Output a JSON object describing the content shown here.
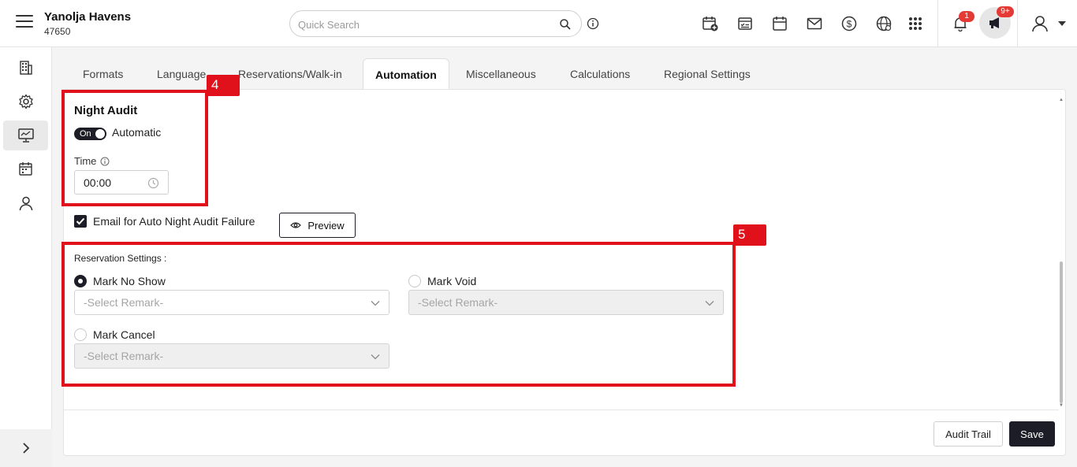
{
  "header": {
    "property_name": "Yanolja Havens",
    "property_id": "47650",
    "search_placeholder": "Quick Search",
    "notification_count": "1",
    "announcement_count": "9+"
  },
  "tabs": [
    {
      "label": "Formats",
      "active": false
    },
    {
      "label": "Language",
      "active": false
    },
    {
      "label": "Reservations/Walk-in",
      "active": false
    },
    {
      "label": "Automation",
      "active": true
    },
    {
      "label": "Miscellaneous",
      "active": false
    },
    {
      "label": "Calculations",
      "active": false
    },
    {
      "label": "Regional Settings",
      "active": false
    }
  ],
  "night_audit": {
    "title": "Night Audit",
    "toggle_state": "On",
    "toggle_label": "Automatic",
    "time_label": "Time",
    "time_value": "00:00",
    "email_checkbox_label": "Email for Auto Night Audit Failure",
    "email_checked": true,
    "preview_label": "Preview"
  },
  "reservation_settings": {
    "title": "Reservation Settings :",
    "options": [
      {
        "label": "Mark No Show",
        "checked": true,
        "remark_placeholder": "-Select Remark-"
      },
      {
        "label": "Mark Void",
        "checked": false,
        "remark_placeholder": "-Select Remark-"
      },
      {
        "label": "Mark Cancel",
        "checked": false,
        "remark_placeholder": "-Select Remark-"
      }
    ]
  },
  "annotations": {
    "tag_4": "4",
    "tag_5": "5",
    "color": "#e0111a"
  },
  "footer": {
    "audit_trail_label": "Audit Trail",
    "save_label": "Save"
  },
  "colors": {
    "primary_dark": "#1d1d27",
    "badge_red": "#e53935"
  }
}
